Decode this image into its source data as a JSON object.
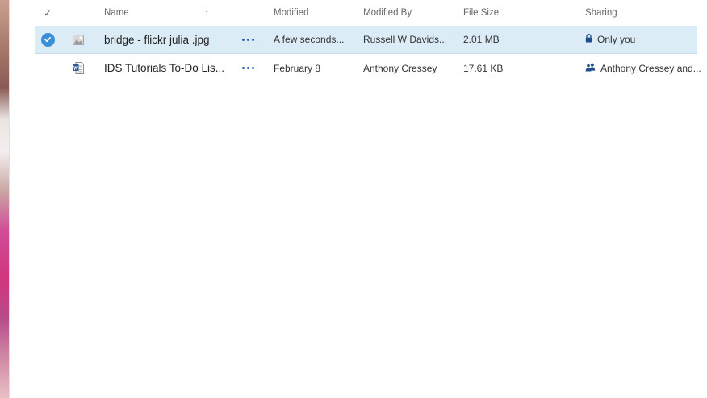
{
  "header": {
    "check_glyph": "✓",
    "name": "Name",
    "sort_indicator": "↑",
    "modified": "Modified",
    "modified_by": "Modified By",
    "file_size": "File Size",
    "sharing": "Sharing"
  },
  "files": [
    {
      "selected": true,
      "type_icon": "image-file-icon",
      "name": "bridge - flickr julia .jpg",
      "modified": "A few seconds...",
      "modified_by": "Russell W Davids...",
      "file_size": "2.01 MB",
      "sharing_icon": "lock-icon",
      "sharing": "Only you"
    },
    {
      "selected": false,
      "type_icon": "word-document-icon",
      "name": "IDS Tutorials To-Do Lis...",
      "modified": "February 8",
      "modified_by": "Anthony Cressey",
      "file_size": "17.61 KB",
      "sharing_icon": "people-icon",
      "sharing": "Anthony Cressey and..."
    }
  ],
  "colors": {
    "selection_background": "#dcecf6",
    "accent": "#3a8fd8",
    "more_dots": "#2a64b4",
    "word_blue": "#2b5797"
  }
}
